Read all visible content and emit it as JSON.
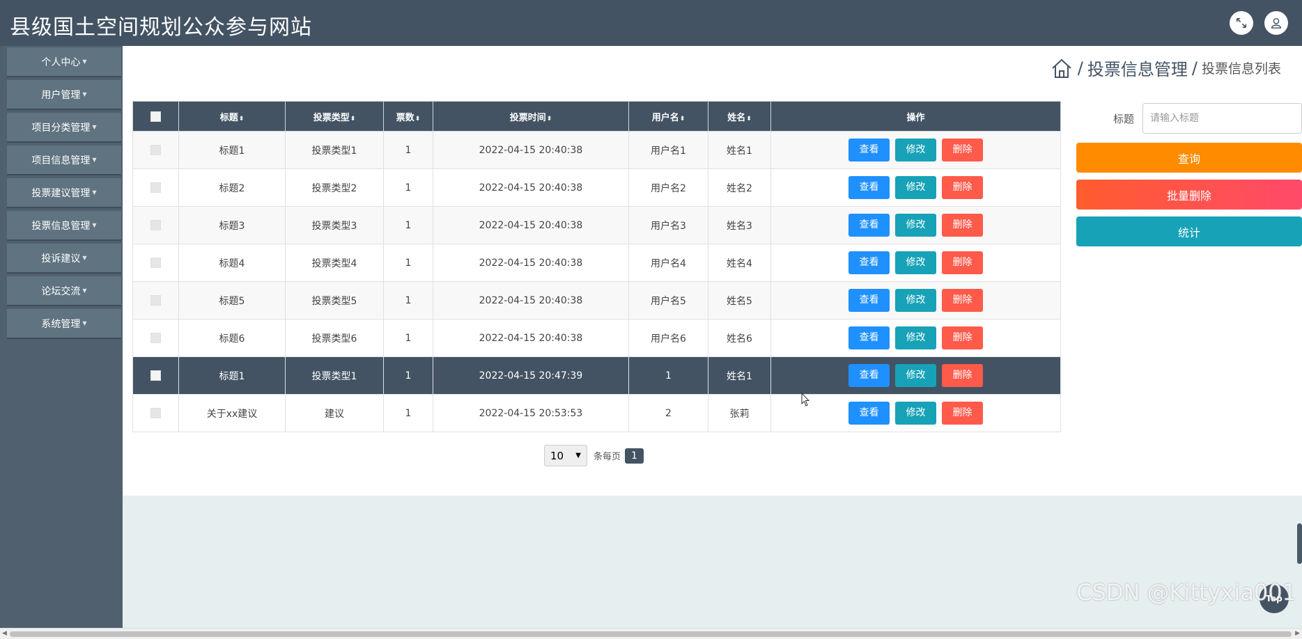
{
  "header": {
    "title": "县级国土空间规划公众参与网站",
    "icons": [
      "fullscreen-icon",
      "user-icon"
    ]
  },
  "sidebar": {
    "items": [
      {
        "label": "个人中心"
      },
      {
        "label": "用户管理"
      },
      {
        "label": "项目分类管理"
      },
      {
        "label": "项目信息管理"
      },
      {
        "label": "投票建议管理"
      },
      {
        "label": "投票信息管理"
      },
      {
        "label": "投诉建议"
      },
      {
        "label": "论坛交流"
      },
      {
        "label": "系统管理"
      }
    ]
  },
  "breadcrumb": {
    "home_icon": "home-icon",
    "section": "投票信息管理",
    "page": "投票信息列表"
  },
  "table": {
    "columns": [
      "标题",
      "投票类型",
      "票数",
      "投票时间",
      "用户名",
      "姓名",
      "操作"
    ],
    "rows": [
      {
        "title": "标题1",
        "type": "投票类型1",
        "votes": "1",
        "time": "2022-04-15 20:40:38",
        "username": "用户名1",
        "name": "姓名1"
      },
      {
        "title": "标题2",
        "type": "投票类型2",
        "votes": "1",
        "time": "2022-04-15 20:40:38",
        "username": "用户名2",
        "name": "姓名2"
      },
      {
        "title": "标题3",
        "type": "投票类型3",
        "votes": "1",
        "time": "2022-04-15 20:40:38",
        "username": "用户名3",
        "name": "姓名3"
      },
      {
        "title": "标题4",
        "type": "投票类型4",
        "votes": "1",
        "time": "2022-04-15 20:40:38",
        "username": "用户名4",
        "name": "姓名4"
      },
      {
        "title": "标题5",
        "type": "投票类型5",
        "votes": "1",
        "time": "2022-04-15 20:40:38",
        "username": "用户名5",
        "name": "姓名5"
      },
      {
        "title": "标题6",
        "type": "投票类型6",
        "votes": "1",
        "time": "2022-04-15 20:40:38",
        "username": "用户名6",
        "name": "姓名6"
      },
      {
        "title": "标题1",
        "type": "投票类型1",
        "votes": "1",
        "time": "2022-04-15 20:47:39",
        "username": "1",
        "name": "姓名1"
      },
      {
        "title": "关于xx建议",
        "type": "建议",
        "votes": "1",
        "time": "2022-04-15 20:53:53",
        "username": "2",
        "name": "张莉"
      }
    ],
    "actions": {
      "view": "查看",
      "edit": "修改",
      "delete": "删除"
    }
  },
  "pagination": {
    "page_size": "10",
    "per_page_label": "条每页",
    "current_page": "1"
  },
  "search": {
    "label": "标题",
    "placeholder": "请输入标题",
    "query_button": "查询",
    "batch_delete_button": "批量删除",
    "stats_button": "统计"
  },
  "misc": {
    "top_button": "Top",
    "watermark": "CSDN @Kittyxia001"
  },
  "colors": {
    "primary_dark": "#435363",
    "view": "#1e90ff",
    "edit": "#17a2b8",
    "delete": "#ff5a4a",
    "query": "#ff8c00"
  }
}
